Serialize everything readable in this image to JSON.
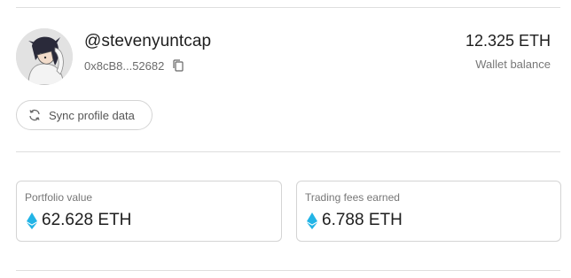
{
  "profile": {
    "username": "@stevenyuntcap",
    "address": "0x8cB8...52682",
    "avatar_icon": "avatar-illustration",
    "copy_icon": "copy-icon"
  },
  "wallet": {
    "balance": "12.325 ETH",
    "label": "Wallet balance"
  },
  "sync": {
    "label": "Sync profile data",
    "icon": "refresh-icon"
  },
  "cards": [
    {
      "label": "Portfolio value",
      "value": "62.628 ETH",
      "icon": "eth-diamond-icon"
    },
    {
      "label": "Trading fees earned",
      "value": "6.788 ETH",
      "icon": "eth-diamond-icon"
    }
  ],
  "colors": {
    "eth_icon": "#22b4e6",
    "divider": "#dedede",
    "border": "#d4d4d4"
  }
}
